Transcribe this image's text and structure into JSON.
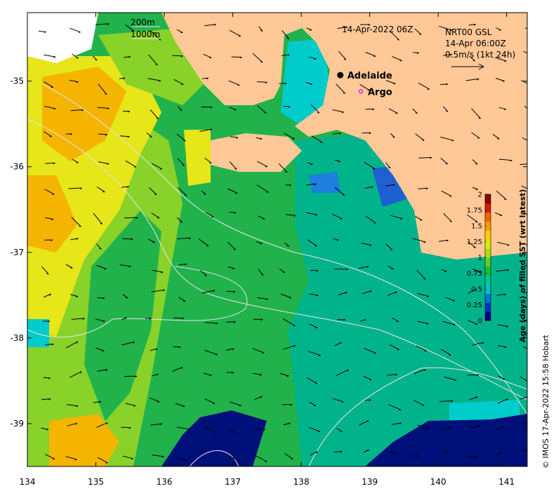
{
  "map": {
    "date_label": "14-Apr-2022 06Z",
    "contours": {
      "shallow": "200m",
      "deep": "1000m"
    },
    "currents": {
      "source": "NRT00 GSL",
      "time": "14-Apr 06:00Z",
      "scale": "0.5m/s (1kt 24h)"
    },
    "places": [
      {
        "name": "Adelaide",
        "lon": 138.57,
        "lat": -34.93,
        "marker": "dot"
      },
      {
        "name": "Argo",
        "lon": 138.87,
        "lat": -35.12,
        "marker": "ring"
      }
    ],
    "axes": {
      "lon_range": [
        134,
        141.3
      ],
      "lat_range": [
        -39.5,
        -34.2
      ],
      "x_ticks": [
        {
          "v": 134,
          "t": "134"
        },
        {
          "v": 135,
          "t": "135"
        },
        {
          "v": 136,
          "t": "136"
        },
        {
          "v": 137,
          "t": "137"
        },
        {
          "v": 138,
          "t": "138"
        },
        {
          "v": 139,
          "t": "139"
        },
        {
          "v": 140,
          "t": "140"
        },
        {
          "v": 141,
          "t": "141"
        }
      ],
      "y_ticks": [
        {
          "v": -35,
          "t": "-35"
        },
        {
          "v": -36,
          "t": "-36"
        },
        {
          "v": -37,
          "t": "-37"
        },
        {
          "v": -38,
          "t": "-38"
        },
        {
          "v": -39,
          "t": "-39"
        }
      ]
    },
    "colorbar": {
      "title": "Age (days) of filled SST (wrt latest)",
      "min": 0,
      "max": 2,
      "ticks": [
        {
          "v": 0,
          "t": "0"
        },
        {
          "v": 0.25,
          "t": "0.25"
        },
        {
          "v": 0.5,
          "t": "0.5"
        },
        {
          "v": 0.75,
          "t": "0.75"
        },
        {
          "v": 1,
          "t": "1"
        },
        {
          "v": 1.25,
          "t": "1.25"
        },
        {
          "v": 1.5,
          "t": "1.5"
        },
        {
          "v": 1.75,
          "t": "1.75"
        },
        {
          "v": 2,
          "t": "2"
        }
      ],
      "colors": [
        "#000080",
        "#0033cc",
        "#0077dd",
        "#11bbcc",
        "#00cc99",
        "#22bb33",
        "#66cc22",
        "#aadd11",
        "#ddee00",
        "#ffcc00",
        "#ff9900",
        "#ee6600",
        "#cc2200",
        "#880000"
      ]
    },
    "credit": "© IMOS 17-Apr-2022 15:58 Hobart",
    "colors": {
      "land": "#ffc896",
      "contour": "#e6e6e6",
      "water_green": "#22b24c",
      "water_teal": "#00b38a",
      "water_lime": "#88d22a",
      "water_yellow": "#e6e619",
      "water_orange": "#f5b400",
      "water_cyan": "#00cccc",
      "water_navy": "#00107a"
    }
  }
}
